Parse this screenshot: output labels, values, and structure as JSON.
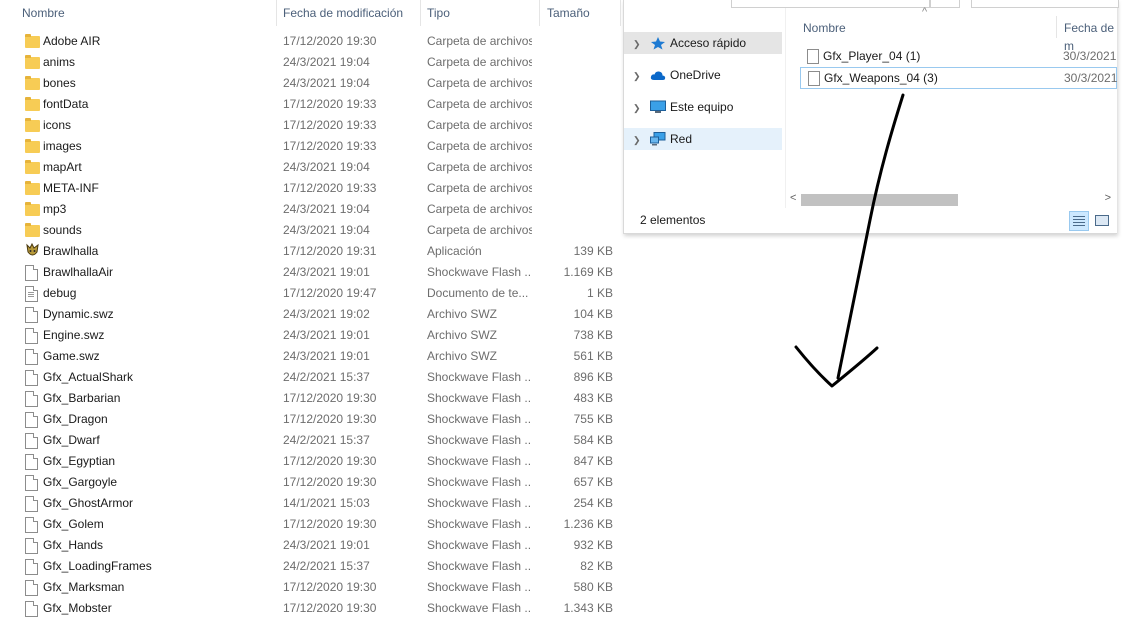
{
  "main": {
    "columns": {
      "name": "Nombre",
      "date": "Fecha de modificación",
      "type": "Tipo",
      "size": "Tamaño"
    },
    "rows": [
      {
        "name": "Adobe AIR",
        "date": "17/12/2020 19:30",
        "type": "Carpeta de archivos",
        "size": "",
        "icon": "folder-icon"
      },
      {
        "name": "anims",
        "date": "24/3/2021 19:04",
        "type": "Carpeta de archivos",
        "size": "",
        "icon": "folder-icon"
      },
      {
        "name": "bones",
        "date": "24/3/2021 19:04",
        "type": "Carpeta de archivos",
        "size": "",
        "icon": "folder-icon"
      },
      {
        "name": "fontData",
        "date": "17/12/2020 19:33",
        "type": "Carpeta de archivos",
        "size": "",
        "icon": "folder-icon"
      },
      {
        "name": "icons",
        "date": "17/12/2020 19:33",
        "type": "Carpeta de archivos",
        "size": "",
        "icon": "folder-icon"
      },
      {
        "name": "images",
        "date": "17/12/2020 19:33",
        "type": "Carpeta de archivos",
        "size": "",
        "icon": "folder-icon"
      },
      {
        "name": "mapArt",
        "date": "24/3/2021 19:04",
        "type": "Carpeta de archivos",
        "size": "",
        "icon": "folder-icon"
      },
      {
        "name": "META-INF",
        "date": "17/12/2020 19:33",
        "type": "Carpeta de archivos",
        "size": "",
        "icon": "folder-icon"
      },
      {
        "name": "mp3",
        "date": "24/3/2021 19:04",
        "type": "Carpeta de archivos",
        "size": "",
        "icon": "folder-icon"
      },
      {
        "name": "sounds",
        "date": "24/3/2021 19:04",
        "type": "Carpeta de archivos",
        "size": "",
        "icon": "folder-icon"
      },
      {
        "name": "Brawlhalla",
        "date": "17/12/2020 19:31",
        "type": "Aplicación",
        "size": "139 KB",
        "icon": "brawlhalla-app-icon"
      },
      {
        "name": "BrawlhallaAir",
        "date": "24/3/2021 19:01",
        "type": "Shockwave Flash ...",
        "size": "1.169 KB",
        "icon": "file-icon"
      },
      {
        "name": "debug",
        "date": "17/12/2020 19:47",
        "type": "Documento de te...",
        "size": "1 KB",
        "icon": "text-document-icon"
      },
      {
        "name": "Dynamic.swz",
        "date": "24/3/2021 19:02",
        "type": "Archivo SWZ",
        "size": "104 KB",
        "icon": "file-icon"
      },
      {
        "name": "Engine.swz",
        "date": "24/3/2021 19:01",
        "type": "Archivo SWZ",
        "size": "738 KB",
        "icon": "file-icon"
      },
      {
        "name": "Game.swz",
        "date": "24/3/2021 19:01",
        "type": "Archivo SWZ",
        "size": "561 KB",
        "icon": "file-icon"
      },
      {
        "name": "Gfx_ActualShark",
        "date": "24/2/2021 15:37",
        "type": "Shockwave Flash ...",
        "size": "896 KB",
        "icon": "file-icon"
      },
      {
        "name": "Gfx_Barbarian",
        "date": "17/12/2020 19:30",
        "type": "Shockwave Flash ...",
        "size": "483 KB",
        "icon": "file-icon"
      },
      {
        "name": "Gfx_Dragon",
        "date": "17/12/2020 19:30",
        "type": "Shockwave Flash ...",
        "size": "755 KB",
        "icon": "file-icon"
      },
      {
        "name": "Gfx_Dwarf",
        "date": "24/2/2021 15:37",
        "type": "Shockwave Flash ...",
        "size": "584 KB",
        "icon": "file-icon"
      },
      {
        "name": "Gfx_Egyptian",
        "date": "17/12/2020 19:30",
        "type": "Shockwave Flash ...",
        "size": "847 KB",
        "icon": "file-icon"
      },
      {
        "name": "Gfx_Gargoyle",
        "date": "17/12/2020 19:30",
        "type": "Shockwave Flash ...",
        "size": "657 KB",
        "icon": "file-icon"
      },
      {
        "name": "Gfx_GhostArmor",
        "date": "14/1/2021 15:03",
        "type": "Shockwave Flash ...",
        "size": "254 KB",
        "icon": "file-icon"
      },
      {
        "name": "Gfx_Golem",
        "date": "17/12/2020 19:30",
        "type": "Shockwave Flash ...",
        "size": "1.236 KB",
        "icon": "file-icon"
      },
      {
        "name": "Gfx_Hands",
        "date": "24/3/2021 19:01",
        "type": "Shockwave Flash ...",
        "size": "932 KB",
        "icon": "file-icon"
      },
      {
        "name": "Gfx_LoadingFrames",
        "date": "24/2/2021 15:37",
        "type": "Shockwave Flash ...",
        "size": "82 KB",
        "icon": "file-icon"
      },
      {
        "name": "Gfx_Marksman",
        "date": "17/12/2020 19:30",
        "type": "Shockwave Flash ...",
        "size": "580 KB",
        "icon": "file-icon"
      },
      {
        "name": "Gfx_Mobster",
        "date": "17/12/2020 19:30",
        "type": "Shockwave Flash ...",
        "size": "1.343 KB",
        "icon": "file-icon"
      }
    ]
  },
  "dialog": {
    "nav": [
      {
        "label": "Acceso rápido",
        "icon": "star-icon",
        "state": "selected"
      },
      {
        "label": "OneDrive",
        "icon": "cloud-icon",
        "state": "normal"
      },
      {
        "label": "Este equipo",
        "icon": "monitor-icon",
        "state": "normal"
      },
      {
        "label": "Red",
        "icon": "network-icon",
        "state": "hover"
      }
    ],
    "columns": {
      "name": "Nombre",
      "date": "Fecha de m"
    },
    "files": [
      {
        "name": "Gfx_Player_04 (1)",
        "date": "30/3/2021"
      },
      {
        "name": "Gfx_Weapons_04 (3)",
        "date": "30/3/2021"
      }
    ],
    "status": "2 elementos"
  },
  "colors": {
    "header_text": "#4c607a",
    "folder": "#f7cc55",
    "selection": "#cce8ff",
    "nav_selected": "#e5e5e5",
    "nav_hover": "#e5f1fb",
    "annotation_ink": "#000000"
  }
}
